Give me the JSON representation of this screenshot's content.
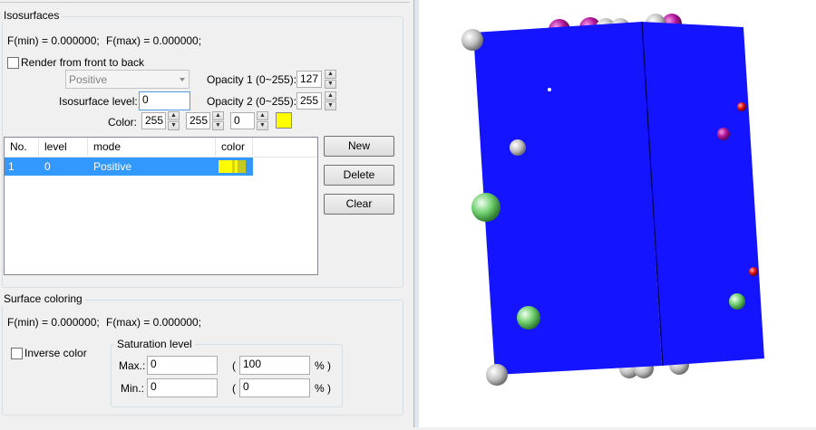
{
  "isosurfaces": {
    "title": "Isosurfaces",
    "fmin_label": "F(min) = 0.000000;",
    "fmax_label": "F(max) = 0.000000;",
    "render_checkbox_label": "Render from front to back",
    "render_checked": false,
    "mode_select_value": "Positive",
    "opacity1_label": "Opacity 1 (0~255):",
    "opacity1_value": "127",
    "opacity2_label": "Opacity 2 (0~255):",
    "opacity2_value": "255",
    "level_label": "Isosurface level:",
    "level_value": "0",
    "color_label": "Color:",
    "color_r": "255",
    "color_g": "255",
    "color_b": "0",
    "swatch_color": "#ffff00",
    "table": {
      "columns": [
        "No.",
        "level",
        "mode",
        "color"
      ],
      "rows": [
        {
          "no": "1",
          "level": "0",
          "mode": "Positive",
          "color": "#ffff00"
        }
      ]
    },
    "buttons": {
      "new": "New",
      "delete": "Delete",
      "clear": "Clear"
    }
  },
  "surface_coloring": {
    "title": "Surface coloring",
    "fmin_label": "F(min) = 0.000000;",
    "fmax_label": "F(max) = 0.000000;",
    "inverse_label": "Inverse color",
    "inverse_checked": false,
    "saturation_title": "Saturation level",
    "max_label": "Max.:",
    "max_value": "0",
    "max_pct_value": "100",
    "min_label": "Min.:",
    "min_value": "0",
    "min_pct_value": "0",
    "open_paren": "(",
    "pct_close": "% )"
  },
  "viewport": {
    "surface_color": "#1414ff",
    "atom_colors": {
      "gray": "#c8c8c8",
      "purple": "#b0169a",
      "green": "#6fcf6f",
      "red": "#e01010"
    }
  }
}
